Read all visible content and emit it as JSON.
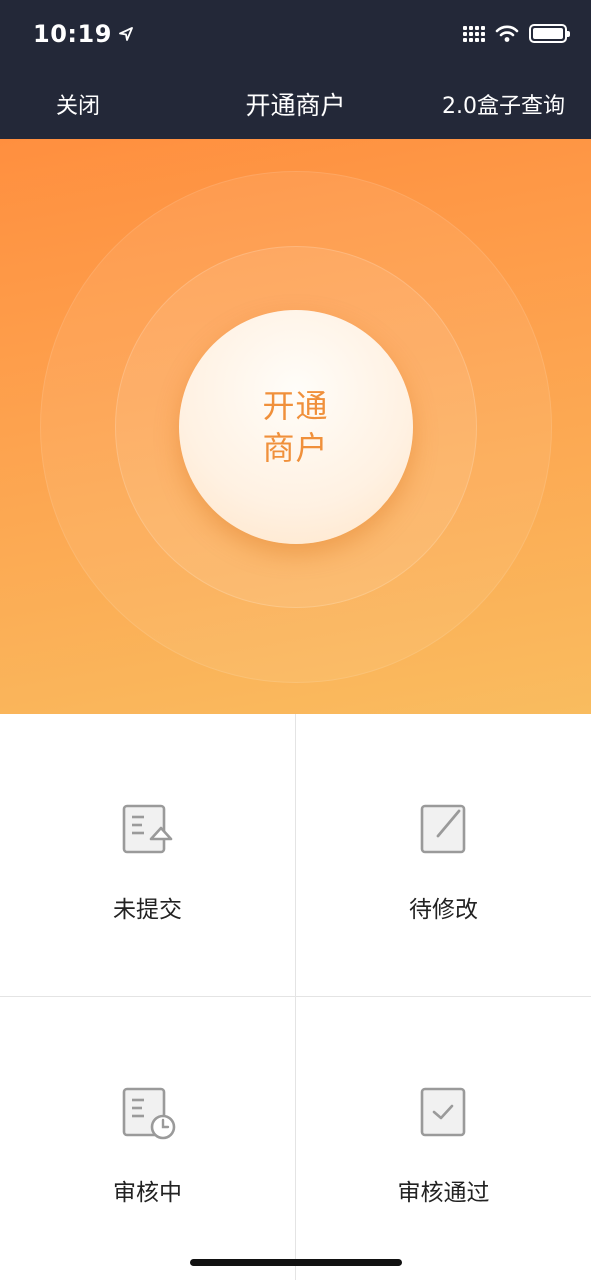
{
  "status_bar": {
    "time": "10:19",
    "location_icon": "location-arrow-icon",
    "signal_icon": "cellular-signal-icon",
    "wifi_icon": "wifi-icon",
    "battery_icon": "battery-icon"
  },
  "nav": {
    "close_label": "关闭",
    "title": "开通商户",
    "right_label": "2.0盒子查询"
  },
  "hero": {
    "button_line1": "开通",
    "button_line2": "商户",
    "colors": {
      "gradient_top": "#ff8f3f",
      "gradient_bottom": "#f9bc5f",
      "button_text": "#f0903b"
    }
  },
  "statuses": [
    {
      "label": "未提交",
      "icon": "document-upload-icon"
    },
    {
      "label": "待修改",
      "icon": "edit-document-icon"
    },
    {
      "label": "审核中",
      "icon": "document-clock-icon"
    },
    {
      "label": "审核通过",
      "icon": "document-check-icon"
    }
  ],
  "colors": {
    "header_bg": "#232838",
    "icon_gray": "#9a9a9a"
  }
}
